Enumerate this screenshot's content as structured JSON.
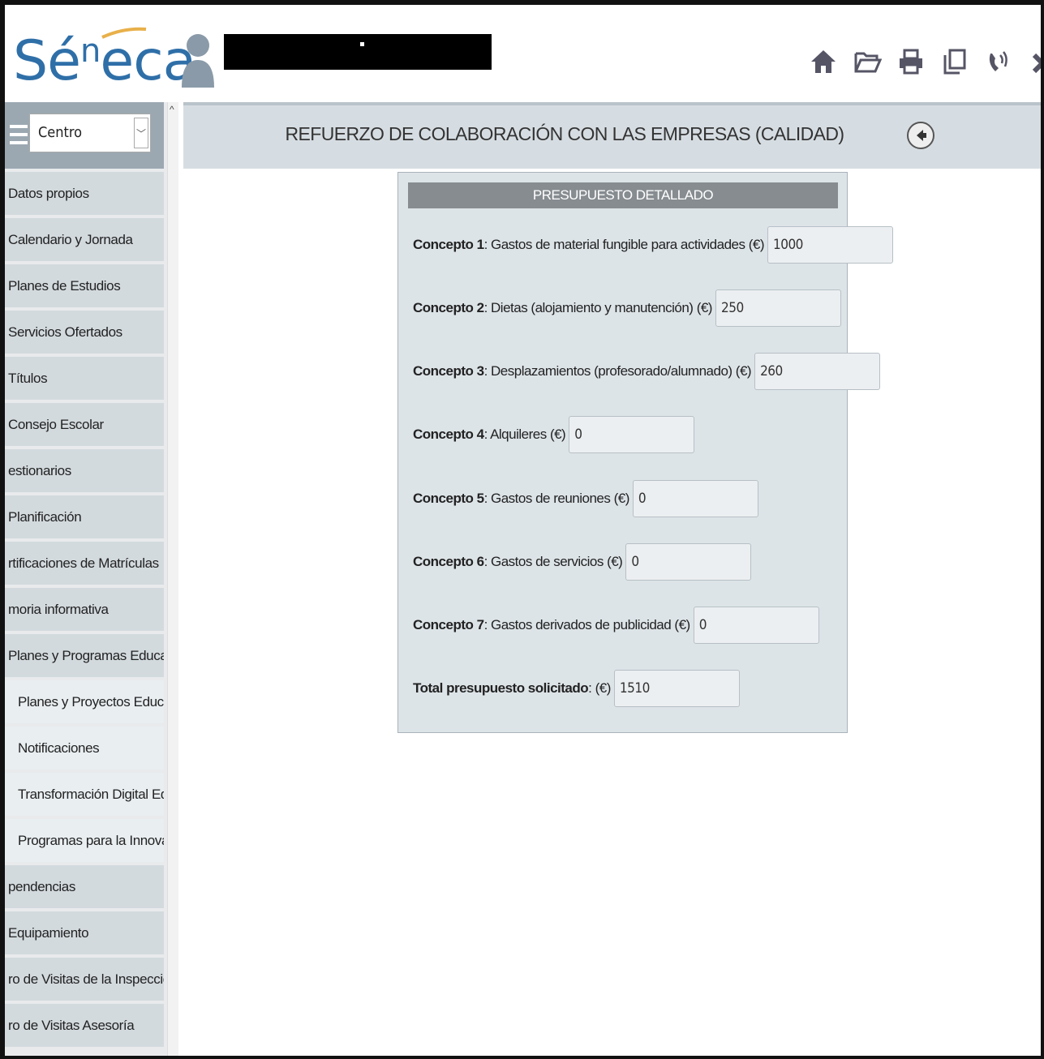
{
  "app": {
    "logo_main": "Sé",
    "logo_sup": "n",
    "logo_rest": "eca"
  },
  "header": {
    "icons": [
      "home-icon",
      "folder-open-icon",
      "print-icon",
      "copy-icon",
      "phone-icon",
      "close-icon"
    ]
  },
  "sidebar": {
    "select_value": "Centro",
    "items": [
      {
        "label": "Datos propios",
        "sub": false
      },
      {
        "label": "Calendario y Jornada",
        "sub": false
      },
      {
        "label": "Planes de Estudios",
        "sub": false
      },
      {
        "label": "Servicios Ofertados",
        "sub": false
      },
      {
        "label": "Títulos",
        "sub": false
      },
      {
        "label": "Consejo Escolar",
        "sub": false
      },
      {
        "label": "estionarios",
        "sub": false
      },
      {
        "label": "Planificación",
        "sub": false
      },
      {
        "label": "rtificaciones de Matrículas",
        "sub": false
      },
      {
        "label": "moria informativa",
        "sub": false
      },
      {
        "label": "Planes y Programas Educativos",
        "sub": false
      },
      {
        "label": "Planes y Proyectos Educativos",
        "sub": true
      },
      {
        "label": "Notificaciones",
        "sub": true
      },
      {
        "label": "Transformación Digital Educat",
        "sub": true
      },
      {
        "label": "Programas para la Innovación",
        "sub": true
      },
      {
        "label": "pendencias",
        "sub": false
      },
      {
        "label": "Equipamiento",
        "sub": false
      },
      {
        "label": "ro de Visitas de la Inspección",
        "sub": false
      },
      {
        "label": "ro de Visitas Asesoría",
        "sub": false
      }
    ]
  },
  "main": {
    "title": "REFUERZO DE COLABORACIÓN CON LAS EMPRESAS (CALIDAD)",
    "panel_title": "PRESUPUESTO DETALLADO",
    "rows": [
      {
        "bold": "Concepto 1",
        "text": ": Gastos de material fungible para actividades (€)",
        "value": "1000"
      },
      {
        "bold": "Concepto 2",
        "text": ": Dietas (alojamiento y manutención) (€)",
        "value": "250"
      },
      {
        "bold": "Concepto 3",
        "text": ": Desplazamientos (profesorado/alumnado) (€)",
        "value": "260"
      },
      {
        "bold": "Concepto 4",
        "text": ": Alquileres (€)",
        "value": "0"
      },
      {
        "bold": "Concepto 5",
        "text": ": Gastos de reuniones (€)",
        "value": "0"
      },
      {
        "bold": "Concepto 6",
        "text": ": Gastos de servicios (€)",
        "value": "0"
      },
      {
        "bold": "Concepto 7",
        "text": ": Gastos derivados de publicidad (€)",
        "value": "0"
      },
      {
        "bold": "Total presupuesto solicitado",
        "text": ": (€)",
        "value": "1510"
      }
    ]
  }
}
